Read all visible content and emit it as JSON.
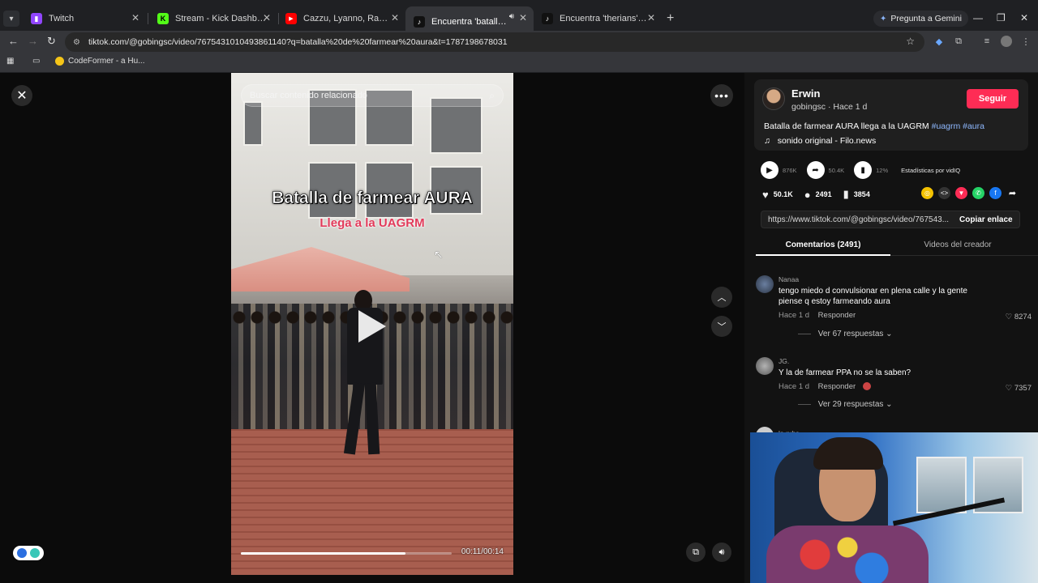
{
  "browser": {
    "tabs": [
      {
        "title": "Twitch",
        "icon": "twitch-icon",
        "color": "#9146ff",
        "glyph": "▮"
      },
      {
        "title": "Stream - Kick Dashboard",
        "icon": "kick-icon",
        "color": "#53fc18",
        "glyph": "K"
      },
      {
        "title": "Cazzu, Lyanno, Rauw Alejandro",
        "icon": "youtube-icon",
        "color": "#ff0000",
        "glyph": "▶"
      },
      {
        "title": "Encuentra 'batalla de farme",
        "icon": "tiktok-icon",
        "color": "#111111",
        "glyph": "♪",
        "active": true
      },
      {
        "title": "Encuentra 'therians' en TikTok |",
        "icon": "tiktok-icon",
        "color": "#111111",
        "glyph": "♪"
      }
    ],
    "gemini_label": "Pregunta a Gemini",
    "url": "tiktok.com/@gobingsc/video/7675431010493861140?q=batalla%20de%20farmear%20aura&t=1787198678031",
    "bookmark": "CodeFormer - a Hu..."
  },
  "video": {
    "search_placeholder": "Buscar contenido relacionado",
    "caption_line1": "Batalla de farmear AURA",
    "caption_line2": "Llega a la UAGRM",
    "time": "00:11/00:14",
    "progress": 0.78
  },
  "author": {
    "name": "Erwin",
    "meta": "gobingsc · Hace 1 d",
    "follow_label": "Seguir",
    "description": "Batalla de farmear AURA llega a la UAGRM",
    "tags": "#uagrm #aura",
    "music": "sonido original - Filo.news"
  },
  "stats": {
    "views": "876K",
    "shares_est": "50.4K",
    "engagement": "12%",
    "vidiq_label": "Estadísticas por vidIQ"
  },
  "actions": {
    "likes": "50.1K",
    "comments": "2491",
    "saves": "3854"
  },
  "share": {
    "link": "https://www.tiktok.com/@gobingsc/video/767543...",
    "copy_label": "Copiar enlace"
  },
  "panel_tabs": {
    "comments": "Comentarios (2491)",
    "creator_videos": "Videos del creador"
  },
  "comments": [
    {
      "user": "Nanaa",
      "text": "tengo miedo d convulsionar en plena calle y la gente piense q estoy farmeando aura",
      "time": "Hace 1 d",
      "reply": "Responder",
      "likes": "8274",
      "replies": "Ver 67 respuestas"
    },
    {
      "user": "JG.",
      "text": "Y la de farmear PPA no se la saben?",
      "time": "Hace 1 d",
      "reply": "Responder",
      "likes": "7357",
      "replies": "Ver 29 respuestas"
    },
    {
      "user": "la rubs",
      "text": "",
      "time": "",
      "reply": "",
      "likes": "",
      "replies": ""
    }
  ]
}
